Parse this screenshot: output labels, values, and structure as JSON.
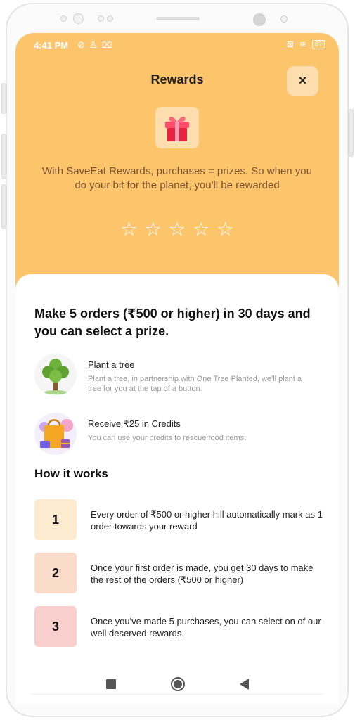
{
  "status_bar": {
    "time": "4:41 PM",
    "left_icons": [
      "alarm-off-icon",
      "person-icon",
      "trash-icon"
    ],
    "right_icons": [
      "no-sim-icon",
      "wifi-icon"
    ],
    "battery": "87"
  },
  "header": {
    "title": "Rewards",
    "close_label": "×",
    "intro_text": "With SaveEat Rewards, purchases = prizes. So when you do your bit for the planet, you'll be rewarded",
    "stars": [
      "☆",
      "☆",
      "☆",
      "☆",
      "☆"
    ],
    "background_color": "#fdc56b"
  },
  "main": {
    "headline": "Make 5 orders (₹500 or higher) in 30 days and you can select a prize.",
    "options": [
      {
        "title": "Plant a tree",
        "description": "Plant a tree, in partnership with One Tree Planted, we'll plant a tree for you at the tap of a button.",
        "icon": "tree-icon"
      },
      {
        "title": "Receive ₹25 in Credits",
        "description": "You can use your credits to rescue food items.",
        "icon": "shopping-bag-icon"
      }
    ],
    "how_it_works_title": "How it works",
    "steps": [
      {
        "number": "1",
        "text": "Every order of ₹500 or higher hill automatically mark as 1 order towards your reward",
        "color": "#fdebd0"
      },
      {
        "number": "2",
        "text": "Once your first order is made, you get 30 days to make the rest of the orders (₹500 or higher)",
        "color": "#fbdccb"
      },
      {
        "number": "3",
        "text": "Once you've made 5 purchases, you can select on of our well deserved rewards.",
        "color": "#f9cfcd"
      }
    ]
  },
  "nav_bar": {
    "icons": [
      "recent-apps-icon",
      "home-icon",
      "back-icon"
    ]
  }
}
